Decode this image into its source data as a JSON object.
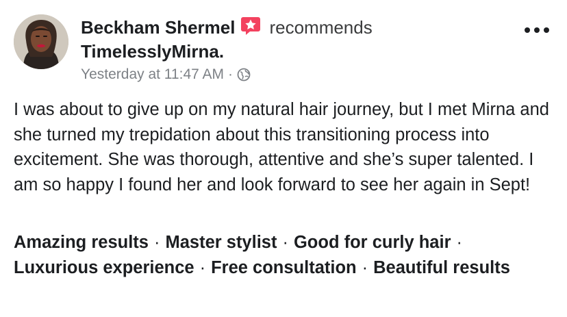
{
  "post": {
    "author": "Beckham Shermel",
    "action": "recommends",
    "page": "TimelesslyMirna",
    "page_suffix": ".",
    "timestamp": "Yesterday at 11:47 AM",
    "separator": "·",
    "privacy_icon": "globe-icon",
    "recommend_icon": "star-speech-bubble-icon",
    "more_icon": "more-options-icon",
    "body": "I was about to give up on my natural hair journey, but I met Mirna and she turned my trepidation about this transitioning process into excitement. She was thorough, attentive and she’s super talented. I am so happy I found her and look forward to see her again in Sept!",
    "tags": [
      "Amazing results",
      "Master stylist",
      "Good for curly hair",
      "Luxurious experience",
      "Free consultation",
      "Beautiful results"
    ],
    "tag_separator": "·"
  },
  "colors": {
    "text": "#1c1e21",
    "meta": "#7d8186",
    "recommend_badge": "#f3425f"
  }
}
